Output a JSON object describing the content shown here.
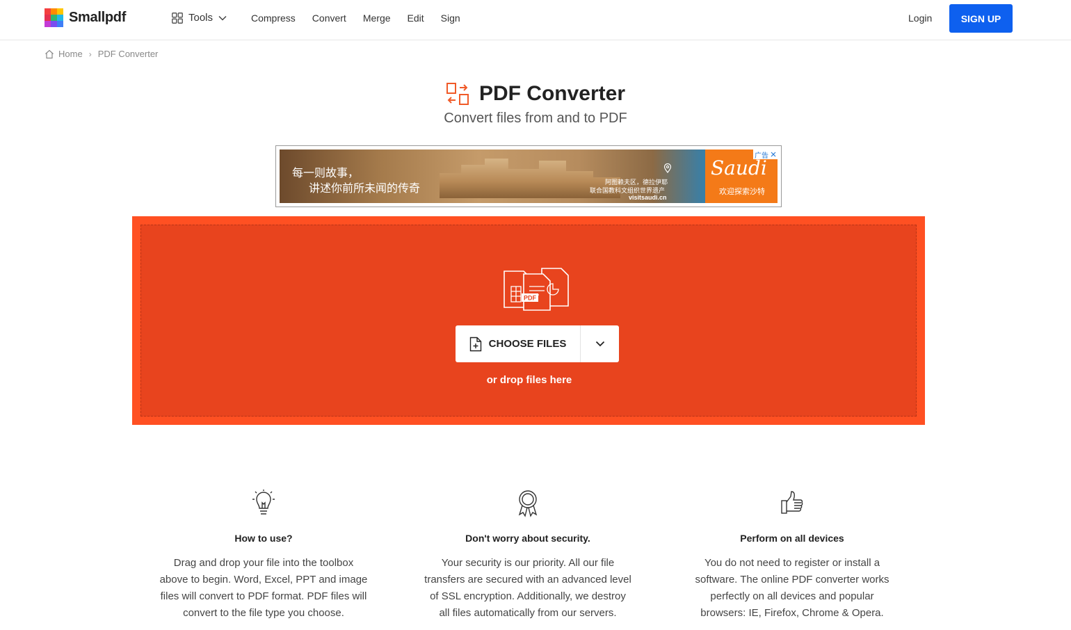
{
  "colors": {
    "brand_red": "#ff5022",
    "dropzone_inner": "#e8441e",
    "signup_blue": "#0e60ef",
    "icon_orange": "#f05a28"
  },
  "header": {
    "logo_text": "Smallpdf",
    "logo_icon": "smallpdf-grid-logo",
    "tools_label": "Tools",
    "nav_items": [
      "Compress",
      "Convert",
      "Merge",
      "Edit",
      "Sign"
    ],
    "login_label": "Login",
    "signup_label": "SIGN UP"
  },
  "breadcrumb": {
    "home_label": "Home",
    "current_label": "PDF Converter"
  },
  "page": {
    "title": "PDF Converter",
    "subtitle": "Convert files from and to PDF",
    "title_icon": "convert-arrows-icon"
  },
  "ad": {
    "line1": "每一则故事，",
    "line2": "讲述你前所未闻的传奇",
    "caption1": "阿图赖夫区，德拉伊耶",
    "caption2": "联合国教科文组织世界遗产",
    "caption3": "visitsaudi.cn",
    "brand_name": "Saudi",
    "brand_sub": "欢迎探索沙特",
    "badge": "广告"
  },
  "dropzone": {
    "choose_label": "CHOOSE FILES",
    "drop_hint": "or drop files here",
    "pdf_tag": "PDF"
  },
  "features": [
    {
      "icon": "lightbulb-icon",
      "title": "How to use?",
      "lines": [
        "Drag and drop your file into the toolbox",
        "above to begin. Word, Excel, PPT and image",
        "files will convert to PDF format. PDF files will",
        "convert to the file type you choose."
      ]
    },
    {
      "icon": "award-ribbon-icon",
      "title": "Don't worry about security.",
      "lines": [
        "Your security is our priority. All our file",
        "transfers are secured with an advanced level",
        "of SSL encryption. Additionally, we destroy",
        "all files automatically from our servers."
      ]
    },
    {
      "icon": "thumbs-up-icon",
      "title": "Perform on all devices",
      "lines": [
        "You do not need to register or install a",
        "software. The online PDF converter works",
        "perfectly on all devices and popular",
        "browsers: IE, Firefox, Chrome & Opera."
      ]
    }
  ]
}
